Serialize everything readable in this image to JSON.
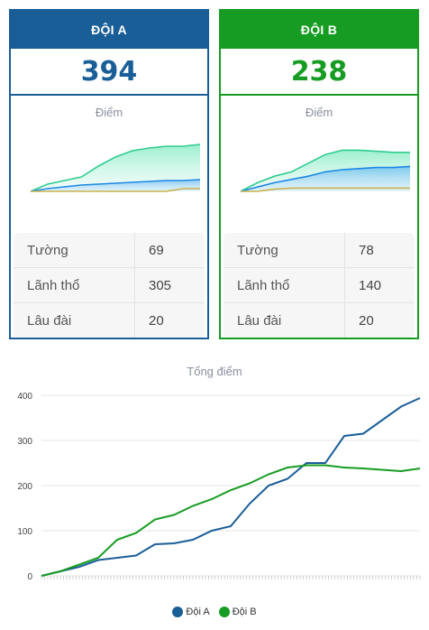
{
  "teams": [
    {
      "name": "ĐỘI A",
      "score": "394",
      "chart_label": "Điểm",
      "color": "#1a5e98",
      "stats": [
        {
          "label": "Tường",
          "value": "69"
        },
        {
          "label": "Lãnh thổ",
          "value": "305"
        },
        {
          "label": "Lâu đài",
          "value": "20"
        }
      ]
    },
    {
      "name": "ĐỘI B",
      "score": "238",
      "chart_label": "Điểm",
      "color": "#169c22",
      "stats": [
        {
          "label": "Tường",
          "value": "78"
        },
        {
          "label": "Lãnh thổ",
          "value": "140"
        },
        {
          "label": "Lâu đài",
          "value": "20"
        }
      ]
    }
  ],
  "total_chart_title": "Tổng điểm",
  "legend": [
    {
      "label": "Đội A",
      "color": "#1a5e98"
    },
    {
      "label": "Đội B",
      "color": "#169c22"
    }
  ],
  "chart_data": [
    {
      "type": "area",
      "name": "team-a-mini",
      "title": "Điểm",
      "x": [
        0,
        10,
        20,
        30,
        40,
        50,
        60,
        70,
        80,
        90,
        100
      ],
      "series": [
        {
          "values": [
            0,
            8,
            12,
            16,
            28,
            38,
            45,
            48,
            50,
            50,
            52
          ],
          "color": "#2ecc8f"
        },
        {
          "values": [
            0,
            3,
            5,
            7,
            8,
            9,
            10,
            11,
            12,
            12,
            13
          ],
          "color": "#1e88e5"
        },
        {
          "values": [
            0,
            0,
            0,
            0,
            0,
            0,
            0,
            0,
            0,
            3,
            3
          ],
          "color": "#c9b24a"
        }
      ],
      "ylim": [
        0,
        60
      ]
    },
    {
      "type": "area",
      "name": "team-b-mini",
      "title": "Điểm",
      "x": [
        0,
        10,
        20,
        30,
        40,
        50,
        60,
        70,
        80,
        90,
        100
      ],
      "series": [
        {
          "values": [
            0,
            8,
            14,
            18,
            26,
            34,
            38,
            38,
            37,
            36,
            36
          ],
          "color": "#2ecc8f"
        },
        {
          "values": [
            0,
            4,
            8,
            11,
            14,
            18,
            20,
            21,
            22,
            22,
            23
          ],
          "color": "#1e88e5"
        },
        {
          "values": [
            0,
            0,
            2,
            3,
            3,
            3,
            3,
            3,
            3,
            3,
            3
          ],
          "color": "#c9b24a"
        }
      ],
      "ylim": [
        0,
        50
      ]
    },
    {
      "type": "line",
      "name": "total-score",
      "title": "Tổng điểm",
      "x": [
        0,
        5,
        10,
        15,
        20,
        25,
        30,
        35,
        40,
        45,
        50,
        55,
        60,
        65,
        70,
        75,
        80,
        85,
        90,
        95,
        100
      ],
      "series": [
        {
          "name": "Đội A",
          "color": "#1a5e98",
          "values": [
            0,
            10,
            20,
            35,
            40,
            45,
            70,
            72,
            80,
            100,
            110,
            160,
            200,
            215,
            250,
            250,
            310,
            315,
            345,
            375,
            394
          ]
        },
        {
          "name": "Đội B",
          "color": "#169c22",
          "values": [
            0,
            10,
            25,
            40,
            80,
            95,
            125,
            135,
            155,
            170,
            190,
            205,
            225,
            240,
            245,
            245,
            240,
            238,
            235,
            232,
            238
          ]
        }
      ],
      "ylim": [
        0,
        400
      ],
      "yticks": [
        0,
        100,
        200,
        300,
        400
      ]
    }
  ]
}
